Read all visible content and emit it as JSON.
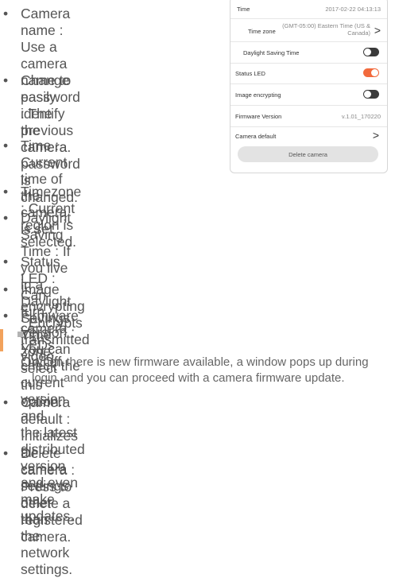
{
  "bullets": [
    {
      "lines": [
        "Camera name : Use a camera",
        "name to easily identify the",
        "camera."
      ]
    },
    {
      "lines": [
        "Change password : The",
        "previous camera password is",
        "changed."
      ]
    },
    {
      "lines": [
        "Time : Current time of the",
        "camera is set."
      ]
    },
    {
      "lines": [
        "Timezone : Current region is selected."
      ]
    },
    {
      "lines": [
        "Daylight Saving Time : If you live in a Daylight Savings",
        "Time zone, select this option."
      ]
    },
    {
      "lines": [
        "Status LED : Can turn camera LEDs On/Off."
      ]
    },
    {
      "lines": [
        "Image encrypting : Encrypts transmitted video."
      ]
    },
    {
      "lines": [
        "Firmware Version : You can check the current version and",
        "the latest distributed version and even make updates."
      ]
    },
    {
      "lines": [
        "Camera default : Initializes all camera settings other than",
        "the network settings."
      ]
    },
    {
      "lines": [
        "Delete camera : Press to delete a registered camera."
      ]
    }
  ],
  "bullet_glyph": "•",
  "note": {
    "lines": [
      "When there is new firmware available, a window pops up during",
      "login, and you can proceed with a camera firmware update."
    ]
  },
  "phone": {
    "time_label": "Time",
    "time_value": "2017-02-22 04:13:13",
    "timezone_label": "Time zone",
    "timezone_value_line1": "(GMT-05:00) Eastern Time (US &",
    "timezone_value_line2": "Canada)",
    "dst_label": "Daylight Saving Time",
    "dst_on": false,
    "status_led_label": "Status LED",
    "status_led_on": true,
    "image_encrypting_label": "Image encrypting",
    "image_encrypting_on": false,
    "firmware_label": "Firmware Version",
    "firmware_value": "v.1.01_170220",
    "camera_default_label": "Camera default",
    "delete_label": "Delete camera",
    "chevron": ">"
  },
  "colors": {
    "toggle_on": "#f26a3d",
    "toggle_off": "#3a3a3a"
  }
}
